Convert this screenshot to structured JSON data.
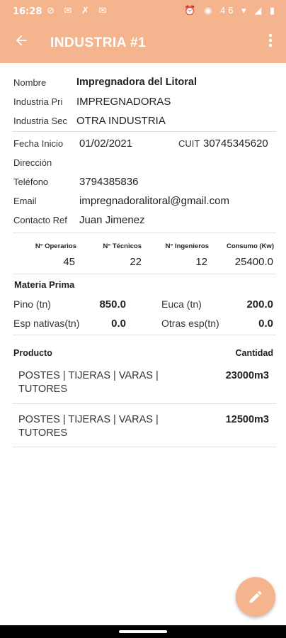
{
  "status": {
    "time": "16:28",
    "left_icons": "⊘ ✉ ✗ ✉",
    "right_icons": "⏰ ◉ 46 ▾ ◢ ▮"
  },
  "appbar": {
    "title": "INDUSTRIA #1"
  },
  "info": {
    "nombre_label": "Nombre",
    "nombre": "Impregnadora del Litoral",
    "ind_pri_label": "Industria Pri",
    "ind_pri": "IMPREGNADORAS",
    "ind_sec_label": "Industria Sec",
    "ind_sec": "OTRA INDUSTRIA",
    "fecha_label": "Fecha Inicio",
    "fecha": "01/02/2021",
    "cuit_label": "CUIT",
    "cuit": "30745345620",
    "direccion_label": "Dirección",
    "direccion": "",
    "telefono_label": "Teléfono",
    "telefono": "3794385836",
    "email_label": "Email",
    "email": "impregnadoralitoral@gmail.com",
    "contacto_label": "Contacto Ref",
    "contacto": "Juan Jimenez"
  },
  "stats": {
    "operarios_label": "N° Operarios",
    "operarios": "45",
    "tecnicos_label": "N° Técnicos",
    "tecnicos": "22",
    "ingenieros_label": "N° Ingenieros",
    "ingenieros": "12",
    "consumo_label": "Consumo (Kw)",
    "consumo": "25400.0"
  },
  "materia_prima": {
    "title": "Materia Prima",
    "pino_label": "Pino (tn)",
    "pino": "850.0",
    "euca_label": "Euca (tn)",
    "euca": "200.0",
    "nativas_label": "Esp nativas(tn)",
    "nativas": "0.0",
    "otras_label": "Otras esp(tn)",
    "otras": "0.0"
  },
  "productos": {
    "header_producto": "Producto",
    "header_cantidad": "Cantidad",
    "items": [
      {
        "name": "POSTES | TIJERAS | VARAS | TUTORES",
        "qty": "23000m3"
      },
      {
        "name": "POSTES | TIJERAS | VARAS | TUTORES",
        "qty": "12500m3"
      }
    ]
  }
}
